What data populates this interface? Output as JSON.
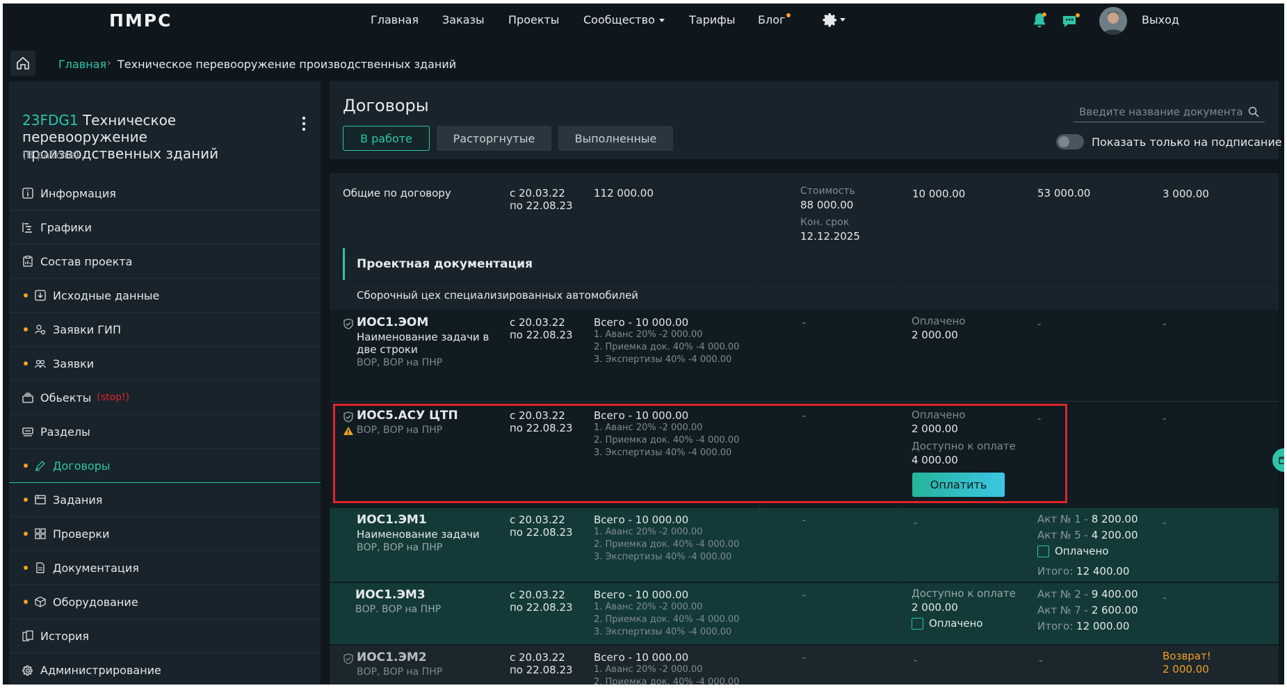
{
  "logo": "ПМРС",
  "nav": {
    "items": [
      "Главная",
      "Заказы",
      "Проекты",
      "Сообщество",
      "Тарифы",
      "Блог"
    ],
    "active": "Проекты",
    "logout": "Выход"
  },
  "breadcrumb": {
    "home": "Главная",
    "current": "Техническое перевооружение производственных зданий"
  },
  "project": {
    "code": "23FDG1",
    "title_line1": "Техническое перевооружение",
    "title_line2": "производственных зданий",
    "status": "(В работе)"
  },
  "sidebar": {
    "items": [
      {
        "label": "Информация",
        "icon": "info-icon"
      },
      {
        "label": "Графики",
        "icon": "gantt-icon"
      },
      {
        "label": "Состав проекта",
        "icon": "clipboard-icon"
      },
      {
        "label": "Исходные данные",
        "icon": "download-icon"
      },
      {
        "label": "Заявки ГИП",
        "icon": "user-gear-icon"
      },
      {
        "label": "Заявки",
        "icon": "users-icon"
      },
      {
        "label": "Обьекты",
        "icon": "layers-icon",
        "tag": "(stop!)"
      },
      {
        "label": "Разделы",
        "icon": "sections-icon"
      },
      {
        "label": "Договоры",
        "icon": "pen-icon"
      },
      {
        "label": "Задания",
        "icon": "tasks-icon"
      },
      {
        "label": "Проверки",
        "icon": "grid-icon"
      },
      {
        "label": "Документация",
        "icon": "document-icon"
      },
      {
        "label": "Оборудование",
        "icon": "box-icon"
      },
      {
        "label": "История",
        "icon": "history-icon"
      },
      {
        "label": "Администрирование",
        "icon": "gear-icon"
      }
    ]
  },
  "contracts": {
    "title": "Договоры",
    "tabs": [
      "В работе",
      "Расторгнутые",
      "Выполненные"
    ],
    "search_placeholder": "Введите название документа",
    "toggle_label": "Показать только на подписание"
  },
  "table": {
    "summary": {
      "label": "Общие по договору",
      "date_from": "с 20.03.22",
      "date_to": "по 22.08.23",
      "amount": "112 000.00",
      "cost_label": "Стоимость",
      "cost": "88 000.00",
      "deadline_label": "Кон. срок",
      "deadline": "12.12.2025",
      "col5": "10 000.00",
      "col6": "53 000.00",
      "col7": "3 000.00"
    },
    "section": "Проектная документация",
    "subsection": "Сборочный цех специализированных автомобилей",
    "stages": [
      "1. Аванс 20% -2 000.00",
      "2. Приемка док. 40% -4 000.00",
      "3. Экспертизы 40% -4 000.00"
    ],
    "rows": [
      {
        "code": "ИОС1.ЭОМ",
        "name1": "Наименование задачи в",
        "name2": "две строки",
        "sub": "ВОР, ВОР на ПНР",
        "date_from": "с 20.03.22",
        "date_to": "по 22.08.23",
        "total": "Всего - 10 000.00",
        "col4": "-",
        "paid_label": "Оплачено",
        "paid": "2 000.00",
        "col6": "-",
        "col7": "-"
      },
      {
        "code": "ИОС5.АСУ ЦТП",
        "sub": "ВОР, ВОР на ПНР",
        "date_from": "с 20.03.22",
        "date_to": "по 22.08.23",
        "total": "Всего - 10 000.00",
        "col4": "-",
        "paid_label": "Оплачено",
        "paid": "2 000.00",
        "avail_label": "Доступно к оплате",
        "avail": "4 000.00",
        "pay_button": "Оплатить",
        "col6": "-",
        "col7": "-"
      },
      {
        "code": "ИОС1.ЭМ1",
        "name1": "Наименование задачи",
        "sub": "ВОР, ВОР на ПНР",
        "date_from": "с 20.03.22",
        "date_to": "по 22.08.23",
        "total": "Всего - 10 000.00",
        "col4": "-",
        "col5": "-",
        "act1_label": "Акт № 1 -",
        "act1": "8 200.00",
        "act2_label": "Акт № 5 -",
        "act2": "4 200.00",
        "paid_check": "Оплачено",
        "total_label": "Итого:",
        "sum": "12 400.00",
        "col7": "-"
      },
      {
        "code": "ИОС1.ЭМ3",
        "sub": "ВОР. ВОР на ПНР",
        "date_from": "с 20.03.22",
        "date_to": "по 22.08.23",
        "total": "Всего - 10 000.00",
        "col4": "-",
        "avail_label": "Доступно к оплате",
        "avail": "2 000.00",
        "paid_check": "Оплачено",
        "act1_label": "Акт № 2 -",
        "act1": "9 400.00",
        "act2_label": "Акт № 7 -",
        "act2": "2 600.00",
        "total_label": "Итого:",
        "sum": "12 000.00",
        "col7": "-"
      },
      {
        "code": "ИОС1.ЭМ2",
        "sub": "ВОР, ВОР на ПНР",
        "date_from": "с 20.03.22",
        "date_to": "по 22.08.23",
        "total": "Всего - 10 000.00",
        "col4": "-",
        "col5": "-",
        "col6": "-",
        "refund_label": "Возврат!",
        "refund": "2 000.00"
      }
    ]
  },
  "colors": {
    "accent": "#2fc4a8",
    "warning": "#f0a224",
    "highlight": "#e0242a",
    "background": "#0f171d"
  }
}
